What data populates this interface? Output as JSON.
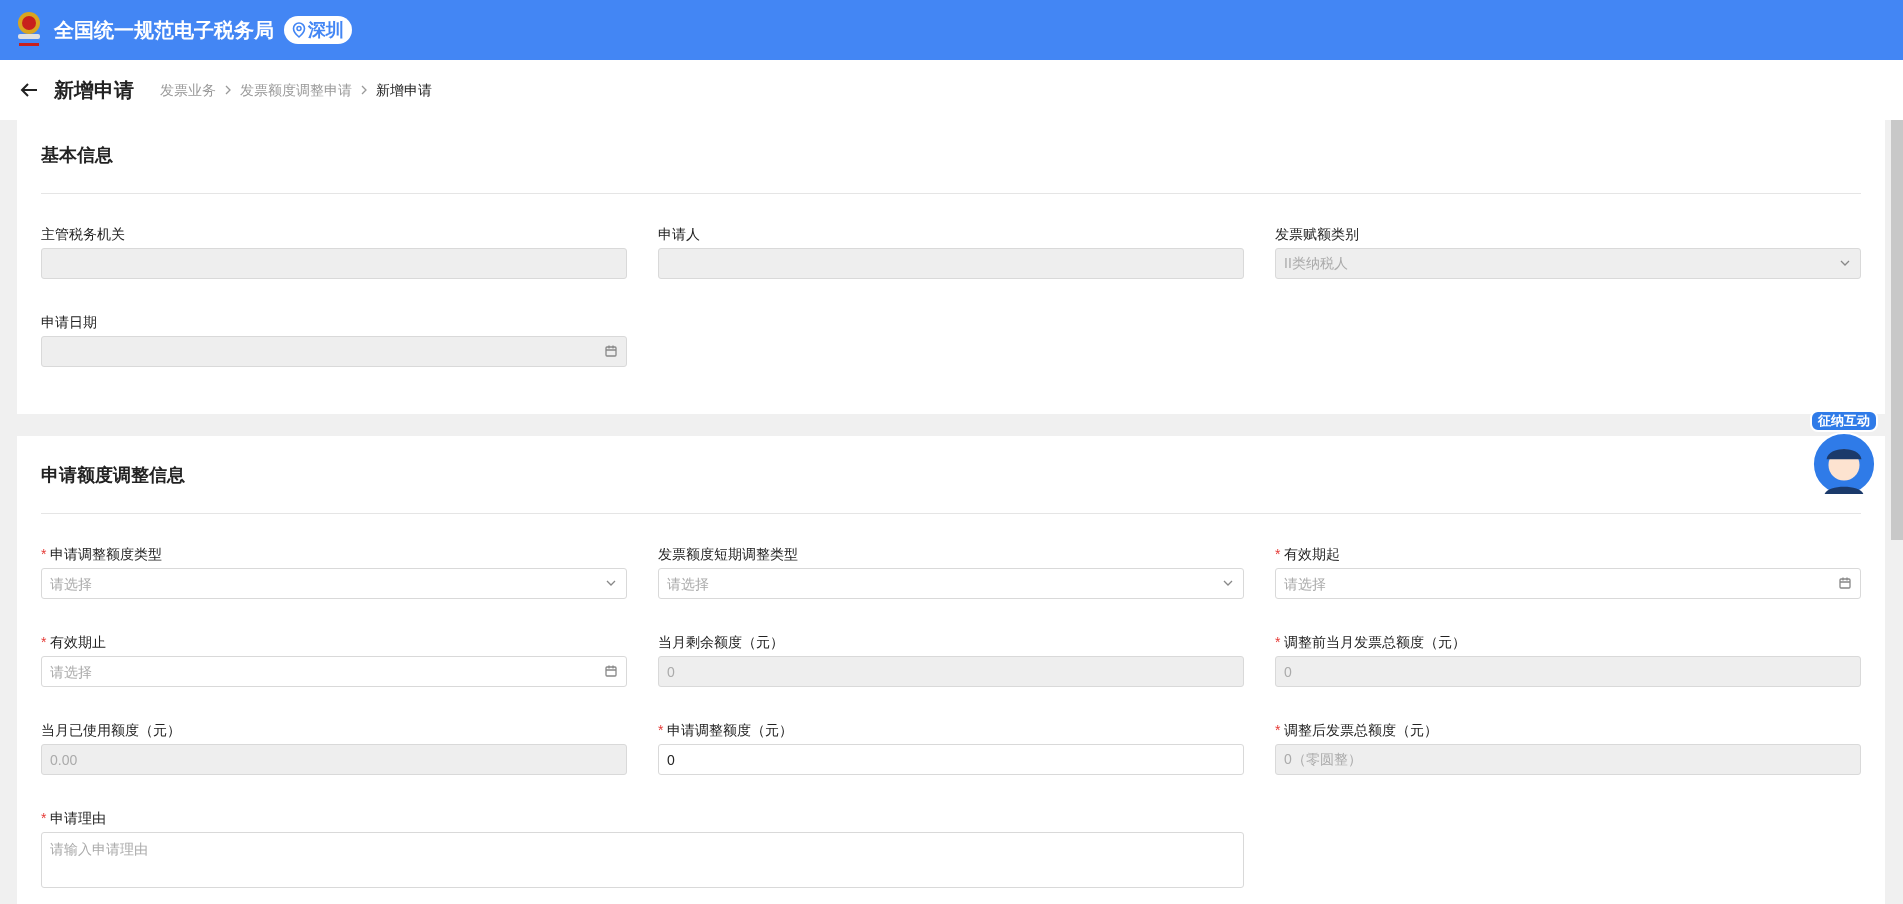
{
  "header": {
    "title": "全国统一规范电子税务局",
    "location": "深圳"
  },
  "page": {
    "title": "新增申请",
    "breadcrumbs": [
      {
        "label": "发票业务",
        "current": false
      },
      {
        "label": "发票额度调整申请",
        "current": false
      },
      {
        "label": "新增申请",
        "current": true
      }
    ]
  },
  "sections": [
    {
      "title": "基本信息",
      "fields": [
        {
          "label": "主管税务机关",
          "kind": "text",
          "disabled": true
        },
        {
          "label": "申请人",
          "kind": "text",
          "disabled": true
        },
        {
          "label": "发票赋额类别",
          "kind": "select",
          "disabled": true,
          "value": "II类纳税人"
        },
        {
          "label": "申请日期",
          "kind": "date",
          "disabled": true
        }
      ]
    },
    {
      "title": "申请额度调整信息",
      "fields": [
        {
          "label": "申请调整额度类型",
          "required_mark": "*",
          "kind": "select",
          "disabled": false,
          "placeholder": "请选择"
        },
        {
          "label": "发票额度短期调整类型",
          "kind": "select",
          "disabled": false,
          "placeholder": "请选择"
        },
        {
          "label": "有效期起",
          "required_mark": "*",
          "kind": "date",
          "disabled": false,
          "placeholder": "请选择"
        },
        {
          "label": "有效期止",
          "required_mark": "*",
          "kind": "date",
          "disabled": false,
          "placeholder": "请选择"
        },
        {
          "label": "当月剩余额度（元）",
          "kind": "text",
          "disabled": true,
          "value": "0"
        },
        {
          "label": "调整前当月发票总额度（元）",
          "required_mark": "*",
          "kind": "text",
          "disabled": true,
          "value": "0"
        },
        {
          "label": "当月已使用额度（元）",
          "kind": "text",
          "disabled": true,
          "value": "0.00"
        },
        {
          "label": "申请调整额度（元）",
          "required_mark": "*",
          "kind": "text",
          "disabled": false,
          "value": "0"
        },
        {
          "label": "调整后发票总额度（元）",
          "required_mark": "*",
          "kind": "text",
          "disabled": true,
          "value": "0（零圆整）"
        },
        {
          "label": "申请理由",
          "required_mark": "*",
          "kind": "textarea",
          "disabled": false,
          "placeholder": "请输入申请理由"
        }
      ]
    }
  ],
  "assistant": {
    "label": "征纳互动"
  }
}
